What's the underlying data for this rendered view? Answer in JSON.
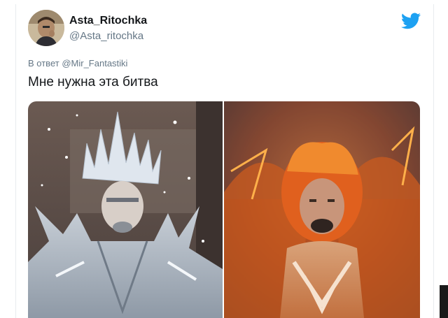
{
  "tweet": {
    "author": {
      "display_name": "Asta_Ritochka",
      "handle": "@Asta_ritochka",
      "avatar_icon": "user-avatar"
    },
    "reply_prefix": "В ответ",
    "reply_to": "@Mir_Fantastiki",
    "text": "Мне нужна эта битва",
    "brand_icon": "twitter-bird-icon",
    "brand_color": "#1da1f2",
    "media": [
      {
        "kind": "photo",
        "subject": "ice-costume"
      },
      {
        "kind": "photo",
        "subject": "fire-costume"
      }
    ]
  }
}
